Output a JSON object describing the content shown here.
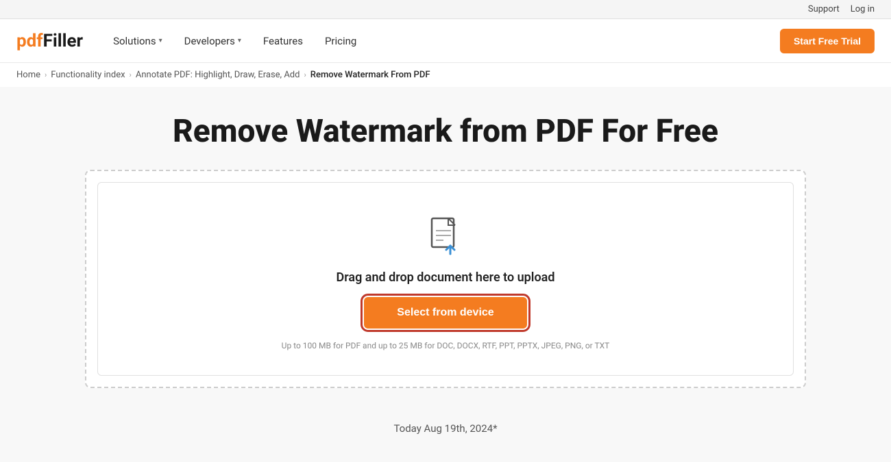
{
  "topbar": {
    "support_label": "Support",
    "login_label": "Log in"
  },
  "navbar": {
    "logo_pdf": "pdf",
    "logo_filler": "Filler",
    "solutions_label": "Solutions",
    "developers_label": "Developers",
    "features_label": "Features",
    "pricing_label": "Pricing",
    "cta_label": "Start Free Trial"
  },
  "breadcrumb": {
    "home": "Home",
    "functionality": "Functionality index",
    "annotate": "Annotate PDF: Highlight, Draw, Erase, Add",
    "current": "Remove Watermark From PDF"
  },
  "hero": {
    "title": "Remove Watermark from PDF For Free"
  },
  "upload": {
    "drag_text": "Drag and drop document here to upload",
    "select_btn": "Select from device",
    "note": "Up to 100 MB for PDF and up to 25 MB for DOC, DOCX, RTF, PPT, PPTX, JPEG, PNG, or TXT"
  },
  "footer": {
    "date_text": "Today Aug 19th, 2024*"
  }
}
